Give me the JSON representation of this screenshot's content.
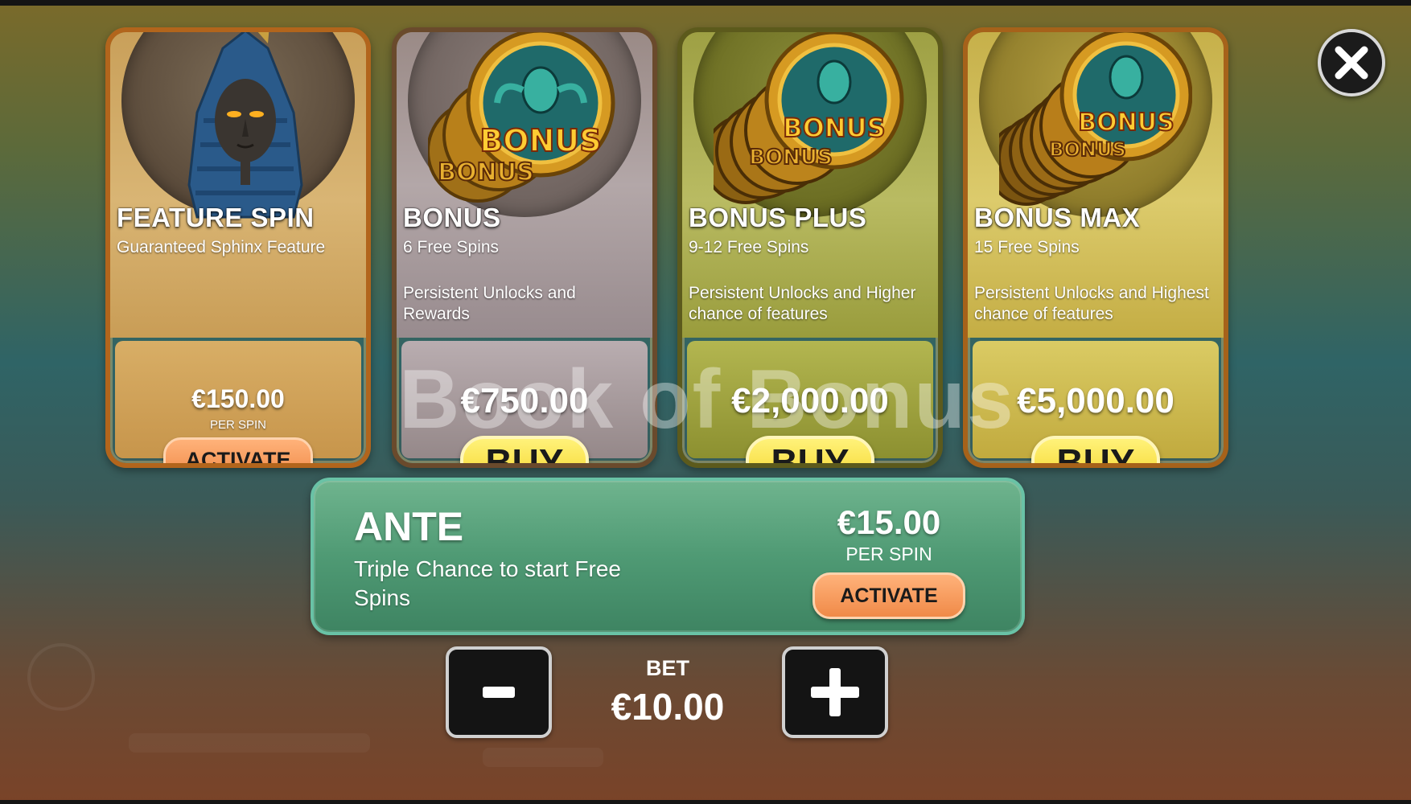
{
  "game": {
    "watermark": "Book of Bonus"
  },
  "cards": [
    {
      "id": "feature-spin",
      "title": "FEATURE SPIN",
      "subtitle": "Guaranteed Sphinx Feature",
      "description": "",
      "price": "€150.00",
      "per_spin": "PER SPIN",
      "button": "ACTIVATE",
      "icon": "sphinx-icon"
    },
    {
      "id": "bonus",
      "title": "BONUS",
      "subtitle": "6 Free Spins",
      "description": "Persistent Unlocks and Rewards",
      "price": "€750.00",
      "button": "BUY",
      "icon": "bonus-coin-stack-icon"
    },
    {
      "id": "bonus-plus",
      "title": "BONUS PLUS",
      "subtitle": "9-12 Free Spins",
      "description": "Persistent Unlocks and Higher chance of features",
      "price": "€2,000.00",
      "button": "BUY",
      "icon": "bonus-coin-stack-icon"
    },
    {
      "id": "bonus-max",
      "title": "BONUS MAX",
      "subtitle": "15 Free Spins",
      "description": "Persistent Unlocks and Highest chance of features",
      "price": "€5,000.00",
      "button": "BUY",
      "icon": "bonus-coin-stack-icon"
    }
  ],
  "coin_text": "BONUS",
  "ante": {
    "title": "ANTE",
    "description": "Triple Chance to start Free Spins",
    "price": "€15.00",
    "per_spin": "PER SPIN",
    "button": "ACTIVATE"
  },
  "bet": {
    "label": "BET",
    "value": "€10.00",
    "decrease_icon": "minus-icon",
    "increase_icon": "plus-icon"
  },
  "close_icon": "close-icon",
  "colors": {
    "activate": "#f08a48",
    "buy": "#f5d52a",
    "ante_green": "#4f9a74"
  }
}
